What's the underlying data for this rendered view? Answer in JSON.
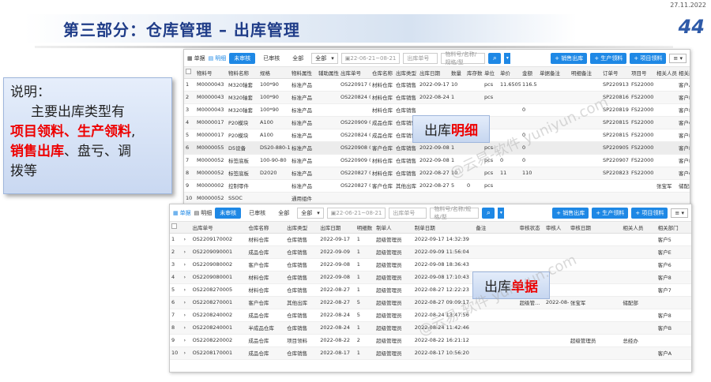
{
  "date": "27.11.2022",
  "title": "第三部分：仓库管理 – 出库管理",
  "slide_no": "44",
  "note": {
    "line1": "说明：",
    "line2": "主要出库类型有",
    "red1": "项目领料、",
    "red2": "生产领料",
    "comma": ",",
    "red3": "销售出库",
    "rest1": "、盘亏、调",
    "rest2": "拨等"
  },
  "label1": {
    "plain": "出库",
    "red": "明细"
  },
  "label2": {
    "plain": "出库",
    "red": "单据"
  },
  "watermark": "@云易-软件 yuniyun.com",
  "win1": {
    "views": [
      "单据",
      "明细"
    ],
    "tabs": [
      "未审核",
      "已审核",
      "全部"
    ],
    "all_select": "全部",
    "date_range": "22-06-21~08-21",
    "order_no_placeholder": "出库单号",
    "material_placeholder": "物料号/名称/规格/型",
    "actions": [
      "+ 销售出库",
      "+ 生产领料",
      "+ 项目领料"
    ],
    "menu": "≡ ▾",
    "headers": [
      "",
      "物料号",
      "物料名称",
      "规格",
      "物料属性",
      "辅助属性",
      "出库单号",
      "仓库名称",
      "出库类型",
      "出库日期",
      "数量",
      "库存数",
      "单位",
      "单价",
      "金额",
      "单据备注",
      "明细备注",
      "订单号",
      "项目号",
      "相关人员",
      "相关部门"
    ],
    "rows": [
      [
        "1",
        "M0000043",
        "M320轴套",
        "100*90",
        "标准产品",
        "",
        "OS220917 0002",
        "材料仓库",
        "仓库销售",
        "2022-09-17",
        "10",
        "",
        "pcs",
        "11.6505",
        "116.5",
        "",
        "",
        "SP220913 0001",
        "FS22000 68",
        "",
        "客户A"
      ],
      [
        "2",
        "M0000043",
        "M320轴套",
        "100*90",
        "标准产品",
        "",
        "OS220824 0002",
        "材料仓库",
        "仓库销售",
        "2022-08-24",
        "1",
        "",
        "pcs",
        "",
        "",
        "",
        "",
        "SP220816 0005",
        "FS22000 45",
        "",
        "客户B"
      ],
      [
        "3",
        "M0000043",
        "M320轴套",
        "100*90",
        "标准产品",
        "",
        "",
        "材料仓库",
        "仓库销售",
        "",
        "",
        "",
        "",
        "",
        "0",
        "",
        "",
        "SP220819 0001",
        "FS22000 46",
        "",
        "客户B"
      ],
      [
        "4",
        "M0000017",
        "P20模块",
        "A100",
        "标准产品",
        "",
        "OS220909 0001",
        "成品仓库",
        "仓库销售",
        "",
        "",
        "",
        "",
        "",
        "",
        "",
        "",
        "SP220815 0002",
        "FS22000 57",
        "",
        "客户C"
      ],
      [
        "5",
        "M0000017",
        "P20模块",
        "A100",
        "标准产品",
        "",
        "OS220824 0001",
        "成品仓库",
        "仓库销售",
        "",
        "",
        "",
        "",
        "",
        "0",
        "",
        "",
        "SP220815 0002",
        "FS22000 45",
        "",
        "客户D"
      ],
      [
        "6",
        "M0000055",
        "D5设备",
        "DS20-880-1",
        "标准产品",
        "",
        "OS220908 0002",
        "客户仓库",
        "仓库销售",
        "2022-09-08",
        "1",
        "",
        "pcs",
        "",
        "0",
        "",
        "",
        "SP220905 0002",
        "FS22000 55",
        "",
        "客户E"
      ],
      [
        "7",
        "M0000052",
        "标签底板",
        "100-90-80",
        "标准产品",
        "",
        "OS220909 0001",
        "材料仓库",
        "仓库销售",
        "2022-09-08",
        "1",
        "",
        "pcs",
        "0",
        "0",
        "",
        "",
        "SP220907 0001",
        "FS22000 54",
        "",
        "客户F"
      ],
      [
        "8",
        "M0000052",
        "标签底板",
        "D2020",
        "标准产品",
        "",
        "OS220827 0005",
        "材料仓库",
        "仓库销售",
        "2022-08-27",
        "10",
        "",
        "pcs",
        "11",
        "110",
        "",
        "",
        "SP220823 0001",
        "FS22000 53",
        "",
        "客户G"
      ],
      [
        "9",
        "M0000002",
        "控制零件",
        "",
        "标准产品",
        "",
        "OS220827 0001",
        "客户仓库",
        "其他出库",
        "2022-08-27",
        "5",
        "0",
        "pcs",
        "",
        "",
        "",
        "",
        "",
        "",
        "张宝军",
        "储配部"
      ],
      [
        "10",
        "M0000052",
        "SSOC",
        "",
        "通用组件",
        "",
        "",
        "",
        "",
        "",
        "",
        "",
        "",
        "",
        "",
        "",
        "",
        "",
        "",
        "",
        ""
      ]
    ]
  },
  "win2": {
    "views": [
      "单据",
      "明细"
    ],
    "tabs": [
      "未审核",
      "已审核",
      "全部"
    ],
    "all_select": "全部",
    "date_range": "22-06-21~08-21",
    "order_no_placeholder": "出库单号",
    "material_placeholder": "物料号/名称/规格/型",
    "actions": [
      "+ 销售出库",
      "+ 生产领料",
      "+ 项目领料"
    ],
    "menu": "≡ ▾",
    "headers": [
      "",
      "",
      "",
      "出库单号",
      "仓库名称",
      "出库类型",
      "出库日期",
      "明细数",
      "制单人",
      "制单日期",
      "备注",
      "审核状态",
      "审核人",
      "审核日期",
      "相关人员",
      "相关部门"
    ],
    "rows": [
      [
        "1",
        "›",
        "OS2209170002",
        "材料仓库",
        "仓库销售",
        "2022-09-17",
        "1",
        "超级管理员",
        "2022-09-17 14:32:39",
        "",
        "",
        "",
        "",
        "",
        "客户5"
      ],
      [
        "2",
        "›",
        "OS2209090001",
        "成品仓库",
        "仓库销售",
        "2022-09-09",
        "1",
        "超级管理员",
        "2022-09-09 11:56:04",
        "",
        "",
        "",
        "",
        "",
        "客户E"
      ],
      [
        "3",
        "›",
        "OS2209080002",
        "客户仓库",
        "仓库销售",
        "2022-09-08",
        "1",
        "超级管理员",
        "2022-09-08 18:36:43",
        "",
        "",
        "",
        "",
        "",
        "客户6"
      ],
      [
        "4",
        "›",
        "OS2209080001",
        "材料仓库",
        "仓库销售",
        "2022-09-08",
        "1",
        "超级管理员",
        "2022-09-08 17:10:43",
        "",
        "",
        "",
        "",
        "",
        "客户8"
      ],
      [
        "5",
        "›",
        "OS2208270005",
        "材料仓库",
        "仓库销售",
        "2022-08-27",
        "1",
        "超级管理员",
        "2022-08-27 12:22:23",
        "",
        "",
        "",
        "",
        "",
        "客户7"
      ],
      [
        "6",
        "›",
        "OS2208270001",
        "客户仓库",
        "其他出库",
        "2022-08-27",
        "5",
        "超级管理员",
        "2022-08-27 09:09:17",
        "",
        "超级管...",
        "2022-08-27 14:51:44",
        "张宝军",
        "储配部",
        ""
      ],
      [
        "7",
        "›",
        "OS2208240002",
        "成品仓库",
        "仓库销售",
        "2022-08-24",
        "5",
        "超级管理员",
        "2022-08-24 13:47:56",
        "",
        "",
        "",
        "",
        "",
        "客户8"
      ],
      [
        "8",
        "›",
        "OS2208240001",
        "半成品仓库",
        "仓库销售",
        "2022-08-24",
        "1",
        "超级管理员",
        "2022-08-24 11:42:46",
        "",
        "",
        "",
        "",
        "",
        "客户B"
      ],
      [
        "9",
        "›",
        "OS2208220002",
        "成品仓库",
        "项目领料",
        "2022-08-22",
        "2",
        "超级管理员",
        "2022-08-22 16:21:12",
        "",
        "",
        "",
        "超级管理员",
        "总经办",
        ""
      ],
      [
        "10",
        "›",
        "OS2208170001",
        "成品仓库",
        "仓库销售",
        "2022-08-17",
        "1",
        "超级管理员",
        "2022-08-17 10:56:20",
        "",
        "",
        "",
        "",
        "",
        "客户A"
      ]
    ]
  }
}
